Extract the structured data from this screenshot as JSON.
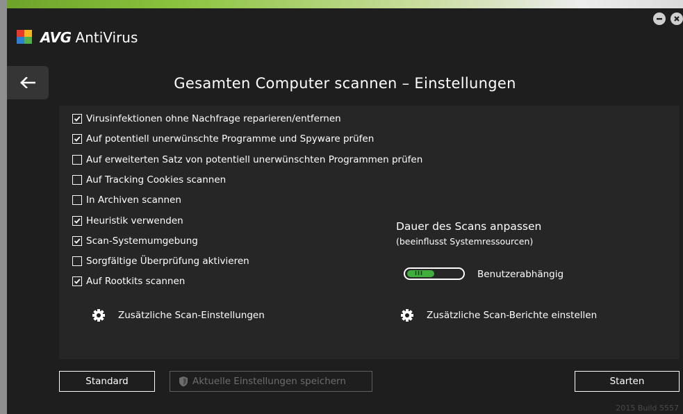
{
  "app": {
    "brand": "AVG",
    "product": "AntiVirus",
    "build": "2015 Build 5557"
  },
  "window_controls": {
    "minimize_icon": "minimize-icon",
    "close_icon": "close-icon"
  },
  "page": {
    "title": "Gesamten Computer scannen – Einstellungen"
  },
  "options": [
    {
      "label": "Virusinfektionen ohne Nachfrage reparieren/entfernen",
      "checked": true
    },
    {
      "label": "Auf potentiell unerwünschte Programme und Spyware prüfen",
      "checked": true
    },
    {
      "label": "Auf erweiterten Satz von potentiell unerwünschten Programmen prüfen",
      "checked": false
    },
    {
      "label": "Auf Tracking Cookies scannen",
      "checked": false
    },
    {
      "label": "In Archiven scannen",
      "checked": false
    },
    {
      "label": "Heuristik verwenden",
      "checked": true
    },
    {
      "label": "Scan-Systemumgebung",
      "checked": true
    },
    {
      "label": "Sorgfältige Überprüfung aktivieren",
      "checked": false
    },
    {
      "label": "Auf Rootkits scannen",
      "checked": true
    }
  ],
  "links": {
    "additional_settings": "Zusätzliche Scan-Einstellungen",
    "additional_reports": "Zusätzliche Scan-Berichte einstellen"
  },
  "duration": {
    "title": "Dauer des Scans anpassen",
    "subtitle": "(beeinflusst Systemressourcen)",
    "level_label": "Benutzerabhängig",
    "level_fraction": 0.5
  },
  "buttons": {
    "default": "Standard",
    "save": "Aktuelle Einstellungen speichern",
    "start": "Starten"
  },
  "colors": {
    "accent_green": "#3fae3d",
    "background": "#1e1e1e",
    "panel": "#262626"
  }
}
